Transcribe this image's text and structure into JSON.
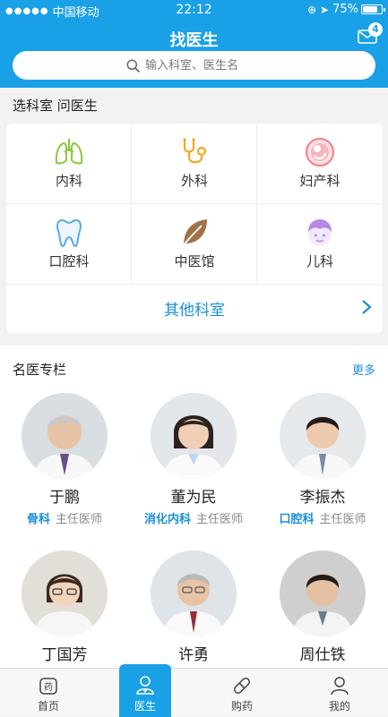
{
  "status_bar": {
    "carrier": "中国移动",
    "time": "22:12",
    "battery": "75%",
    "signal_dots": "●●●●●"
  },
  "header": {
    "title": "找医生",
    "mail_badge": "4"
  },
  "search": {
    "placeholder": "输入科室、医生名"
  },
  "departments": {
    "section_title": "选科室 问医生",
    "items": [
      {
        "label": "内科",
        "icon": "lungs-icon",
        "color": "#8cc63f"
      },
      {
        "label": "外科",
        "icon": "stethoscope-icon",
        "color": "#f5a623"
      },
      {
        "label": "妇产科",
        "icon": "fetus-icon",
        "color": "#f47c8a"
      },
      {
        "label": "口腔科",
        "icon": "tooth-icon",
        "color": "#5aa9e6"
      },
      {
        "label": "中医馆",
        "icon": "leaf-icon",
        "color": "#a0724a"
      },
      {
        "label": "儿科",
        "icon": "child-icon",
        "color": "#b48ae6"
      }
    ],
    "other_label": "其他科室"
  },
  "doctors": {
    "section_title": "名医专栏",
    "more_label": "更多",
    "items": [
      {
        "name": "于鹏",
        "department": "骨科",
        "title": "主任医师"
      },
      {
        "name": "董为民",
        "department": "消化内科",
        "title": "主任医师"
      },
      {
        "name": "李振杰",
        "department": "口腔科",
        "title": "主任医师"
      },
      {
        "name": "丁国芳",
        "department": "",
        "title": ""
      },
      {
        "name": "许勇",
        "department": "",
        "title": ""
      },
      {
        "name": "周仕铁",
        "department": "",
        "title": ""
      }
    ]
  },
  "tabbar": {
    "items": [
      {
        "label": "首页",
        "icon": "medicine-box-icon",
        "active": false
      },
      {
        "label": "医生",
        "icon": "doctor-icon",
        "active": true
      },
      {
        "label": "购药",
        "icon": "pill-icon",
        "active": false
      },
      {
        "label": "我的",
        "icon": "person-icon",
        "active": false
      }
    ]
  },
  "colors": {
    "brand": "#1aa0e6",
    "link": "#1a8fd8",
    "background": "#f2f2f2"
  }
}
